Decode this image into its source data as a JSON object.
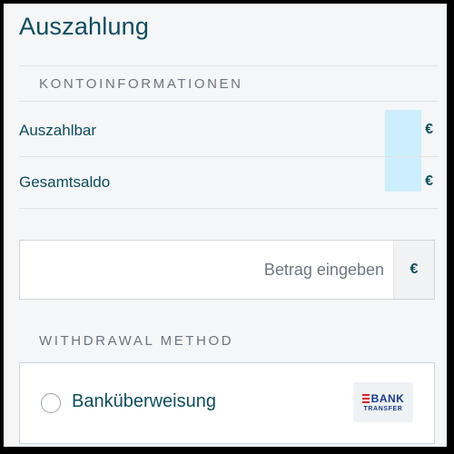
{
  "page": {
    "title": "Auszahlung"
  },
  "account_info": {
    "heading": "KONTOINFORMATIONEN",
    "rows": [
      {
        "label": "Auszahlbar",
        "value": "",
        "currency": "€"
      },
      {
        "label": "Gesamtsaldo",
        "value": "",
        "currency": "€"
      }
    ]
  },
  "amount": {
    "placeholder": "Betrag eingeben",
    "value": "",
    "currency": "€"
  },
  "withdrawal": {
    "heading": "WITHDRAWAL METHOD",
    "methods": [
      {
        "label": "Banküberweisung",
        "selected": false,
        "logo_line1": "BANK",
        "logo_line2": "TRANSFER"
      }
    ]
  },
  "colors": {
    "primary_text": "#0f4c5c",
    "muted_text": "#6b7680",
    "highlight": "#cdeefc",
    "logo_red": "#d8262e",
    "logo_blue": "#1b3a8a"
  }
}
